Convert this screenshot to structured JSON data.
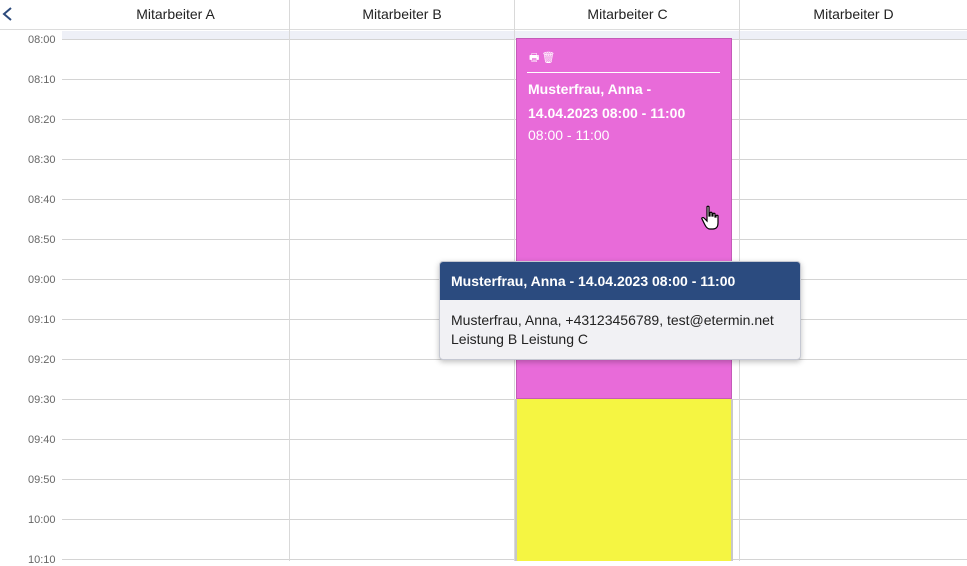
{
  "header": {
    "back_icon": "chevron-left-icon",
    "columns": [
      "Mitarbeiter A",
      "Mitarbeiter B",
      "Mitarbeiter C",
      "Mitarbeiter D"
    ]
  },
  "time_slots": [
    "08:00",
    "08:10",
    "08:20",
    "08:30",
    "08:40",
    "08:50",
    "09:00",
    "09:10",
    "09:20",
    "09:30",
    "09:40",
    "09:50",
    "10:00",
    "10:10"
  ],
  "appointment": {
    "icons": [
      "print-icon",
      "trash-icon"
    ],
    "title": "Musterfrau, Anna - 14.04.2023 08:00 - 11:00",
    "time": "08:00 - 11:00",
    "color": "#e86bd9"
  },
  "second_block": {
    "color": "#f5f542"
  },
  "tooltip": {
    "title": "Musterfrau, Anna - 14.04.2023 08:00 - 11:00",
    "line1": "Musterfrau, Anna, +43123456789, test@etermin.net",
    "line2": "Leistung B Leistung C"
  },
  "colors": {
    "header_accent": "#2b4b7f",
    "grid": "#d4d4d4"
  }
}
